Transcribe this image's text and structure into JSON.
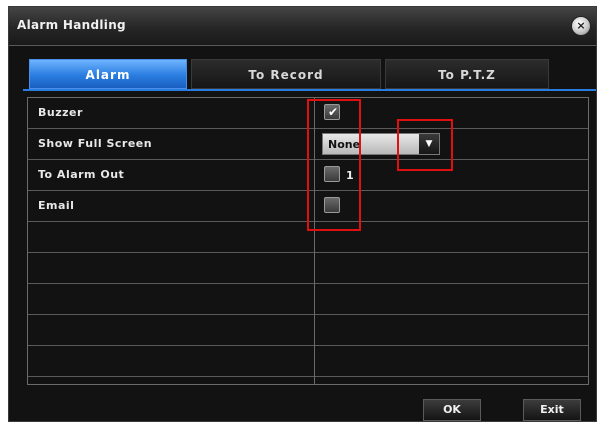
{
  "window": {
    "title": "Alarm Handling",
    "close_icon": "close-icon"
  },
  "tabs": [
    {
      "label": "Alarm",
      "active": true
    },
    {
      "label": "To Record",
      "active": false
    },
    {
      "label": "To P.T.Z",
      "active": false
    }
  ],
  "settings": {
    "buzzer": {
      "label": "Buzzer",
      "checked": true,
      "check_glyph": "✔"
    },
    "show_full_screen": {
      "label": "Show Full Screen",
      "value": "None",
      "arrow_glyph": "▼"
    },
    "to_alarm_out": {
      "label": "To Alarm Out",
      "checked": false,
      "suffix": "1"
    },
    "email": {
      "label": "Email",
      "checked": false
    }
  },
  "buttons": {
    "ok_label": "OK",
    "exit_label": "Exit"
  },
  "colors": {
    "active_tab": "#2a7de0",
    "highlight": "#e01010",
    "background": "#121212"
  }
}
